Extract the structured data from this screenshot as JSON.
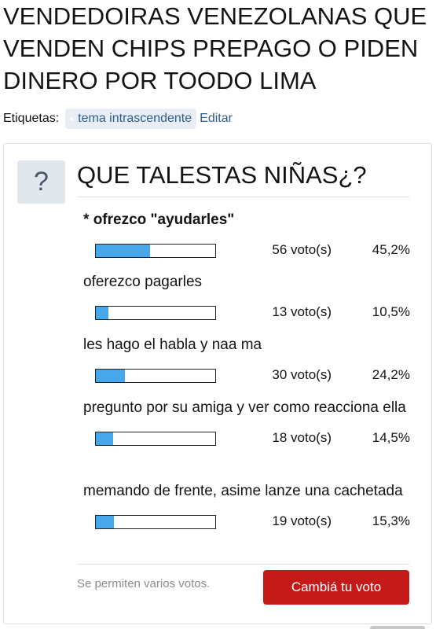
{
  "thread": {
    "title": "VENDEDOIRAS VENEZOLANAS QUE VENDEN CHIPS PREPAGO O PIDEN DINERO POR TOODO LIMA"
  },
  "tags": {
    "label": "Etiquetas:",
    "items": [
      "tema intrascendente"
    ],
    "edit": "Editar"
  },
  "poll": {
    "icon": "question-mark-icon",
    "icon_glyph": "?",
    "question": "QUE TALESTAS NIÑAS¿?",
    "options": [
      {
        "label": "ofrezco \"ayudarles\"",
        "selected": true,
        "marker": "* ",
        "votes": "56 voto(s)",
        "percent": "45,2%",
        "fraction": 0.452
      },
      {
        "label": "oferezco pagarles",
        "selected": false,
        "marker": "",
        "votes": "13 voto(s)",
        "percent": "10,5%",
        "fraction": 0.105
      },
      {
        "label": "les hago el habla y naa ma",
        "selected": false,
        "marker": "",
        "votes": "30 voto(s)",
        "percent": "24,2%",
        "fraction": 0.242
      },
      {
        "label": "pregunto por su amiga y ver como reacciona ella",
        "selected": false,
        "marker": "",
        "votes": "18 voto(s)",
        "percent": "14,5%",
        "fraction": 0.145
      },
      {
        "label": "memando de frente, asime lanze una cachetada",
        "selected": false,
        "marker": "",
        "votes": "19 voto(s)",
        "percent": "15,3%",
        "fraction": 0.153
      }
    ],
    "multi_note": "Se permiten varios votos.",
    "change_vote_button": "Cambiá tu voto"
  },
  "colors": {
    "bar_fill": "#47a7eb",
    "button": "#c51a1a",
    "tag_bg": "#e9eef5",
    "link": "#2d5e8f"
  }
}
